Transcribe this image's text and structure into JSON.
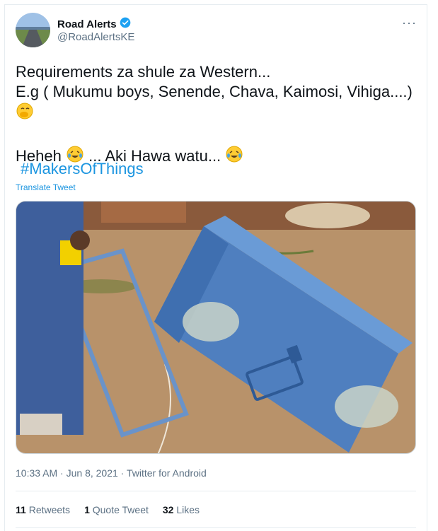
{
  "author": {
    "name": "Road Alerts",
    "handle": "@RoadAlertsKE",
    "verified_icon": "verified-badge-icon"
  },
  "more_icon": "more-options-icon",
  "tweet": {
    "line1": "Requirements za shule za Western...",
    "line2": "E.g ( Mukumu boys, Senende, Chava, Kaimosi, Vihiga....)",
    "line3_emoji": "face-with-hand-over-mouth",
    "line4_start": "Heheh",
    "line4_mid": "... Aki Hawa watu...",
    "line4_emoji": "face-with-tears-of-joy",
    "hashtag": "#MakersOfThings"
  },
  "translate_label": "Translate Tweet",
  "meta": {
    "time": "10:33 AM",
    "sep": " · ",
    "date": "Jun 8, 2021",
    "source": "Twitter for Android"
  },
  "stats": {
    "retweets_count": "11",
    "retweets_label": "Retweets",
    "quotes_count": "1",
    "quotes_label": "Quote Tweet",
    "likes_count": "32",
    "likes_label": "Likes"
  },
  "colors": {
    "link": "#1b95e0",
    "muted": "#5b7083",
    "text": "#0f1419",
    "trunk_blue": "#4f7fbf"
  }
}
